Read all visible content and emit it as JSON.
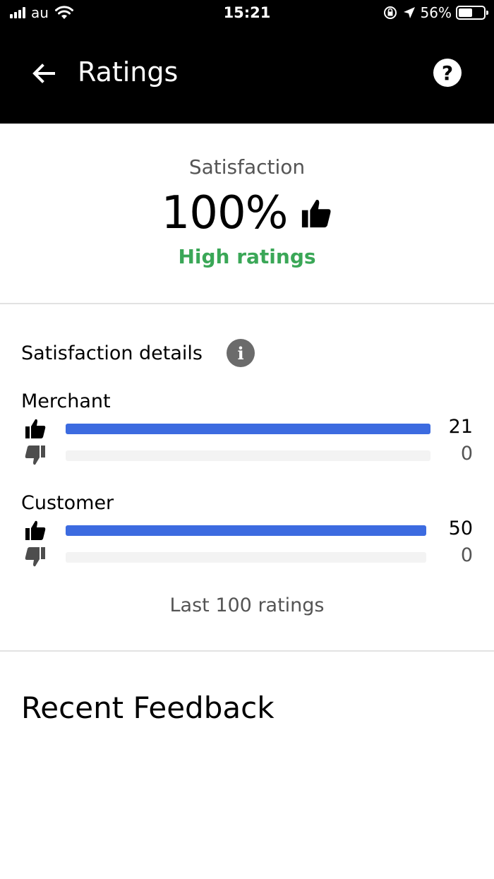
{
  "status_bar": {
    "carrier": "au",
    "time": "15:21",
    "battery": "56%",
    "battery_level": 0.56
  },
  "header": {
    "title": "Ratings",
    "back_icon": "arrow-left-icon",
    "help_icon": "question-circle-icon"
  },
  "summary": {
    "label": "Satisfaction",
    "value": "100%",
    "status": "High ratings",
    "status_color": "#3aa757"
  },
  "details": {
    "title": "Satisfaction details",
    "info_icon": "info-icon",
    "groups": [
      {
        "name": "Merchant",
        "up": "21",
        "down": "0",
        "up_fill": 1.0,
        "down_fill": 0.0
      },
      {
        "name": "Customer",
        "up": "50",
        "down": "0",
        "up_fill": 1.0,
        "down_fill": 0.0
      }
    ],
    "footnote": "Last 100 ratings",
    "bar_color": "#3c6be0"
  },
  "recent": {
    "title": "Recent Feedback"
  }
}
